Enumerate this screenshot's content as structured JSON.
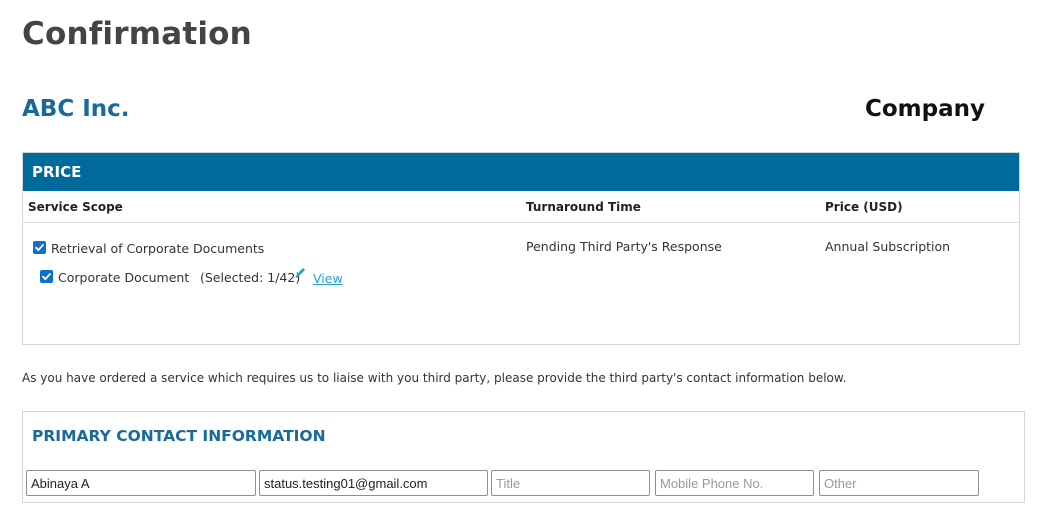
{
  "page": {
    "title": "Confirmation"
  },
  "company": {
    "name": "ABC Inc.",
    "type": "Company"
  },
  "price": {
    "header": "PRICE",
    "columns": {
      "service_scope": "Service Scope",
      "turnaround": "Turnaround Time",
      "price": "Price (USD)"
    },
    "rows": [
      {
        "service": "Retrieval of Corporate Documents",
        "checked": true,
        "turnaround": "Pending Third Party's Response",
        "price": "Annual Subscription",
        "sub_item": {
          "label": "Corporate Document",
          "checked": true,
          "selected": "(Selected: 1/42)",
          "view_label": "View"
        }
      }
    ]
  },
  "notice": "As you have ordered a service which requires us to liaise with you third party, please provide the third party's contact information below.",
  "contact": {
    "title": "PRIMARY CONTACT INFORMATION",
    "name_value": "Abinaya A",
    "email_value": "status.testing01@gmail.com",
    "title_placeholder": "Title",
    "mobile_placeholder": "Mobile Phone No.",
    "other_placeholder": "Other"
  },
  "colors": {
    "brand": "#006a9a",
    "heading": "#176a99",
    "link": "#2a9fd0",
    "checkbox": "#0f6fd1"
  },
  "icons": [
    "checkbox-checked-icon",
    "pencil-icon"
  ]
}
